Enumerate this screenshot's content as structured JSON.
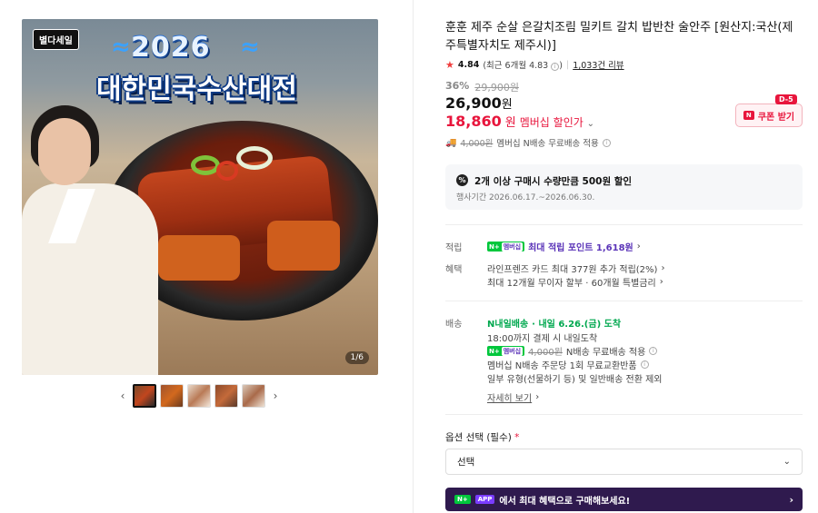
{
  "gallery": {
    "logo_text": "별다세일",
    "banner_year": "2026",
    "banner_title": "대한민국수산대전",
    "counter": "1/6",
    "prev_icon": "chevron-left-icon",
    "next_icon": "chevron-right-icon",
    "thumbnails": 5
  },
  "product": {
    "title": "훈훈 제주 순살 은갈치조림 밀키트 갈치 밥반찬 술안주 [원산지:국산(제주특별자치도 제주시)]",
    "rating": "4.84",
    "rating_recent": "(최근 6개월 4.83",
    "review_count": "1,033건 리뷰",
    "discount_pct": "36%",
    "original_price": "29,900원",
    "price": "26,900",
    "price_unit": "원",
    "member_price": "18,860",
    "member_price_unit": "원",
    "member_label": "멤버십 할인가",
    "coupon_dday": "D-5",
    "coupon_label": "쿠폰 받기",
    "shipping_strike": "4,000원",
    "shipping_text": "멤버십 N배송 무료배송 적용"
  },
  "promo": {
    "title": "2개 이상 구매시 수량만큼 500원 할인",
    "period": "행사기간 2026.06.17.~2026.06.30."
  },
  "benefits": {
    "points_label": "적립",
    "points_badge": "N+",
    "points_badge_sub": "멤버십",
    "points_text": "최대 적립 포인트 1,618원",
    "benefit_label": "혜택",
    "card_text": "라인프렌즈 카드 최대 377원 추가 적립(2%)",
    "installment_text": "최대 12개월 무이자 할부 · 60개월 특별금리",
    "delivery_label": "배송",
    "delivery_badge": "N내일배송",
    "delivery_arrival": "· 내일 6.26.(금) 도착",
    "delivery_cutoff": "18:00까지 결제 시 내일도착",
    "delivery_fee_strike": "4,000원",
    "delivery_fee_text": "N배송 무료배송 적용",
    "exchange_text": "멤버십 N배송 주문당 1회 무료교환반품",
    "exclude_text": "일부 유형(선물하기 등) 및 일반배송 전환 제외",
    "more_link": "자세히 보기"
  },
  "options": {
    "label": "옵션 선택 (필수)",
    "required_mark": "*",
    "placeholder": "선택"
  },
  "app_banner": {
    "badge": "N+",
    "app_badge": "APP",
    "text": "에서 최대 혜택으로 구매해보세요!"
  },
  "colors": {
    "accent_red": "#e8153c",
    "membership_purple": "#5a33b8",
    "naver_green": "#00c73c",
    "banner_bg": "#2f1a4e"
  }
}
